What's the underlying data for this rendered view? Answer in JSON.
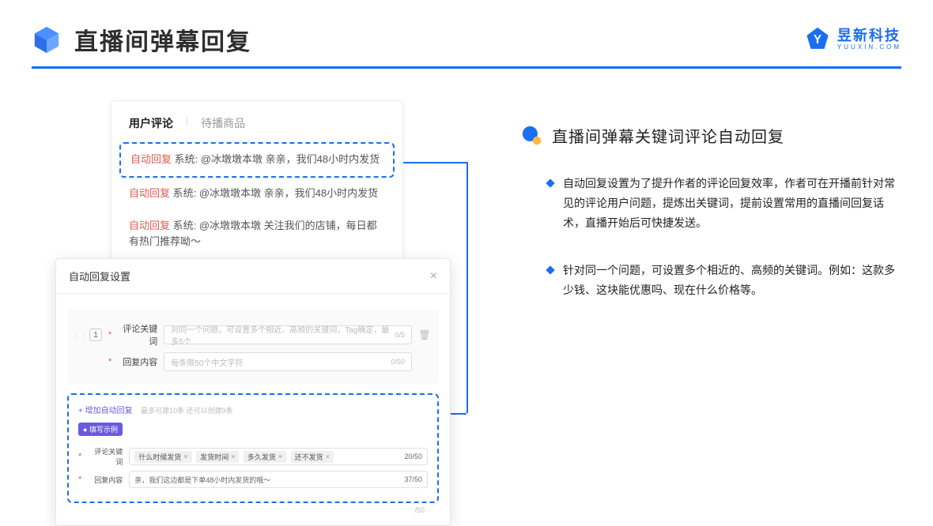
{
  "header": {
    "title": "直播间弹幕回复",
    "brand_name": "昱新科技",
    "brand_sub": "YUUXIN.COM"
  },
  "comments": {
    "tabs": [
      "用户评论",
      "待播商品"
    ],
    "rows": [
      {
        "tag": "自动回复",
        "text": "系统: @冰墩墩本墩 亲亲，我们48小时内发货"
      },
      {
        "tag": "自动回复",
        "text": "系统: @冰墩墩本墩 亲亲，我们48小时内发货"
      },
      {
        "tag": "自动回复",
        "text": "系统: @冰墩墩本墩 关注我们的店铺，每日都有热门推荐呦～"
      }
    ]
  },
  "settings": {
    "title": "自动回复设置",
    "index": "1",
    "keyword_label": "评论关键词",
    "keyword_placeholder": "对同一个问题，可设置多个相近、高频的关键词，Tag确定，最多5个",
    "keyword_counter": "0/5",
    "content_label": "回复内容",
    "content_placeholder": "每条限50个中文字符",
    "content_counter": "0/50",
    "add_link": "+ 增加自动回复",
    "add_hint": "最多可建10条 还可以创建9条",
    "example_badge": "● 填写示例",
    "ex_keyword_label": "评论关键词",
    "ex_tags": [
      "什么时候发货",
      "发货时间",
      "多久发货",
      "还不发货"
    ],
    "ex_keyword_counter": "20/50",
    "ex_content_label": "回复内容",
    "ex_content_value": "亲，我们这边都是下单48小时内发货的哦～",
    "ex_content_counter": "37/50",
    "below_counter": "/50"
  },
  "right": {
    "section_title": "直播间弹幕关键词评论自动回复",
    "bullets": [
      "自动回复设置为了提升作者的评论回复效率，作者可在开播前针对常见的评论用户问题，提炼出关键词，提前设置常用的直播间回复话术，直播开始后可快捷发送。",
      "针对同一个问题，可设置多个相近的、高频的关键词。例如：这款多少钱、这块能优惠吗、现在什么价格等。"
    ]
  }
}
